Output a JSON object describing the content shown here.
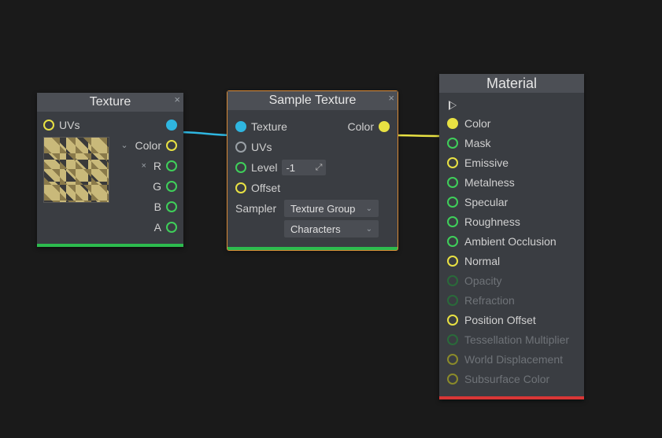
{
  "nodes": {
    "texture": {
      "title": "Texture",
      "inputs": {
        "uvs": "UVs"
      },
      "outputs": {
        "color": "Color",
        "r": "R",
        "g": "G",
        "b": "B",
        "a": "A"
      }
    },
    "sample_texture": {
      "title": "Sample Texture",
      "inputs": {
        "texture": "Texture",
        "uvs": "UVs",
        "level": "Level",
        "offset": "Offset"
      },
      "level_value": "-1",
      "sampler_label": "Sampler",
      "sampler_group": "Texture Group",
      "sampler_value": "Characters",
      "outputs": {
        "color": "Color"
      }
    },
    "material": {
      "title": "Material",
      "inputs": [
        {
          "key": "color",
          "label": "Color",
          "color": "yellow",
          "connected": true,
          "disabled": false
        },
        {
          "key": "mask",
          "label": "Mask",
          "color": "green",
          "connected": false,
          "disabled": false
        },
        {
          "key": "emissive",
          "label": "Emissive",
          "color": "yellow",
          "connected": false,
          "disabled": false
        },
        {
          "key": "metalness",
          "label": "Metalness",
          "color": "green",
          "connected": false,
          "disabled": false
        },
        {
          "key": "specular",
          "label": "Specular",
          "color": "green",
          "connected": false,
          "disabled": false
        },
        {
          "key": "roughness",
          "label": "Roughness",
          "color": "green",
          "connected": false,
          "disabled": false
        },
        {
          "key": "ao",
          "label": "Ambient Occlusion",
          "color": "green",
          "connected": false,
          "disabled": false
        },
        {
          "key": "normal",
          "label": "Normal",
          "color": "yellow",
          "connected": false,
          "disabled": false
        },
        {
          "key": "opacity",
          "label": "Opacity",
          "color": "dkgreen",
          "connected": false,
          "disabled": true
        },
        {
          "key": "refraction",
          "label": "Refraction",
          "color": "dkgreen",
          "connected": false,
          "disabled": true
        },
        {
          "key": "position_offset",
          "label": "Position Offset",
          "color": "yellow",
          "connected": false,
          "disabled": false
        },
        {
          "key": "tess_mult",
          "label": "Tessellation Multiplier",
          "color": "dkgreen",
          "connected": false,
          "disabled": true
        },
        {
          "key": "world_disp",
          "label": "World Displacement",
          "color": "olive",
          "connected": false,
          "disabled": true
        },
        {
          "key": "sss",
          "label": "Subsurface Color",
          "color": "olive",
          "connected": false,
          "disabled": true
        }
      ]
    }
  },
  "wires": [
    {
      "color": "#2fb6e0",
      "from": "texture.texture_out",
      "to": "sample_texture.texture_in"
    },
    {
      "color": "#e8e143",
      "from": "sample_texture.color_out",
      "to": "material.color_in"
    }
  ]
}
